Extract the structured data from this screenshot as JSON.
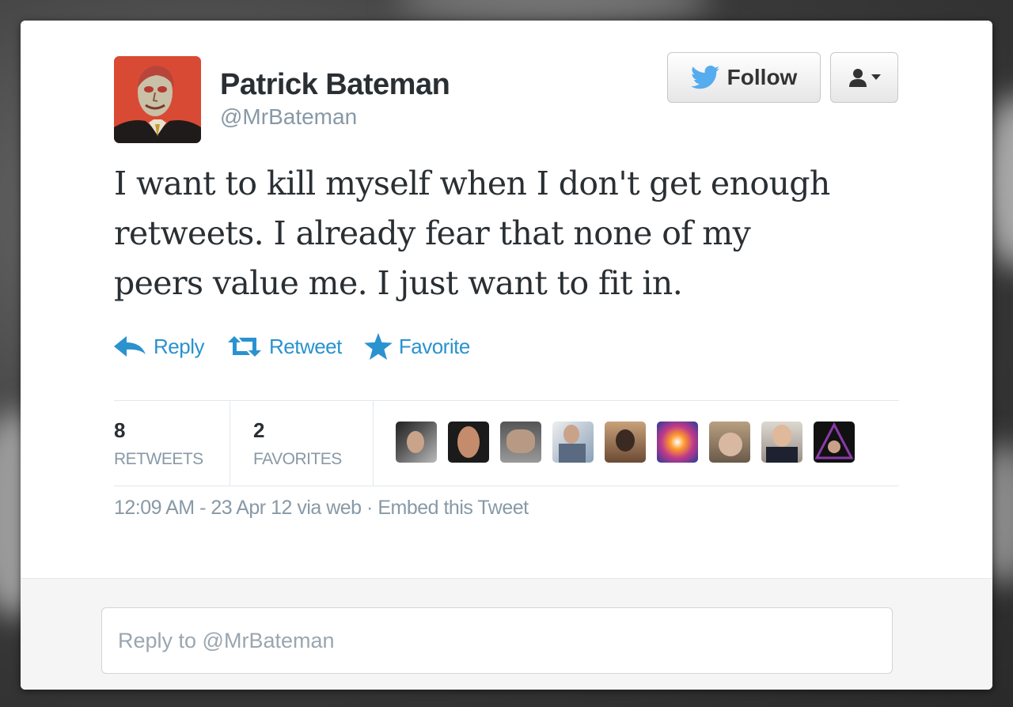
{
  "author": {
    "name": "Patrick Bateman",
    "handle": "@MrBateman",
    "avatar_icon": "portrait-avatar"
  },
  "header_buttons": {
    "follow_label": "Follow",
    "follow_icon": "twitter-bird-icon",
    "user_menu_icon": "user-dropdown-icon"
  },
  "tweet": {
    "text_lines": [
      "I want to kill myself when I don't get enough",
      "retweets. I already fear that none of my",
      "peers value me. I just want to fit in."
    ]
  },
  "actions": [
    {
      "label": "Reply",
      "icon": "reply-arrow-icon"
    },
    {
      "label": "Retweet",
      "icon": "retweet-icon"
    },
    {
      "label": "Favorite",
      "icon": "star-icon"
    }
  ],
  "stats": {
    "retweets": {
      "count": "8",
      "label": "RETWEETS"
    },
    "favorites": {
      "count": "2",
      "label": "FAVORITES"
    },
    "faces_count_note": "9 avatar thumbnails"
  },
  "meta": {
    "time": "12:09 AM - 23 Apr 12 via web",
    "separator": "·",
    "embed": "Embed this Tweet"
  },
  "reply_box": {
    "placeholder": "Reply to @MrBateman"
  },
  "colors": {
    "link_blue": "#2a92cf",
    "text_dark": "#292f33",
    "text_gray": "#8899a6",
    "twitter_blue": "#55acee"
  }
}
